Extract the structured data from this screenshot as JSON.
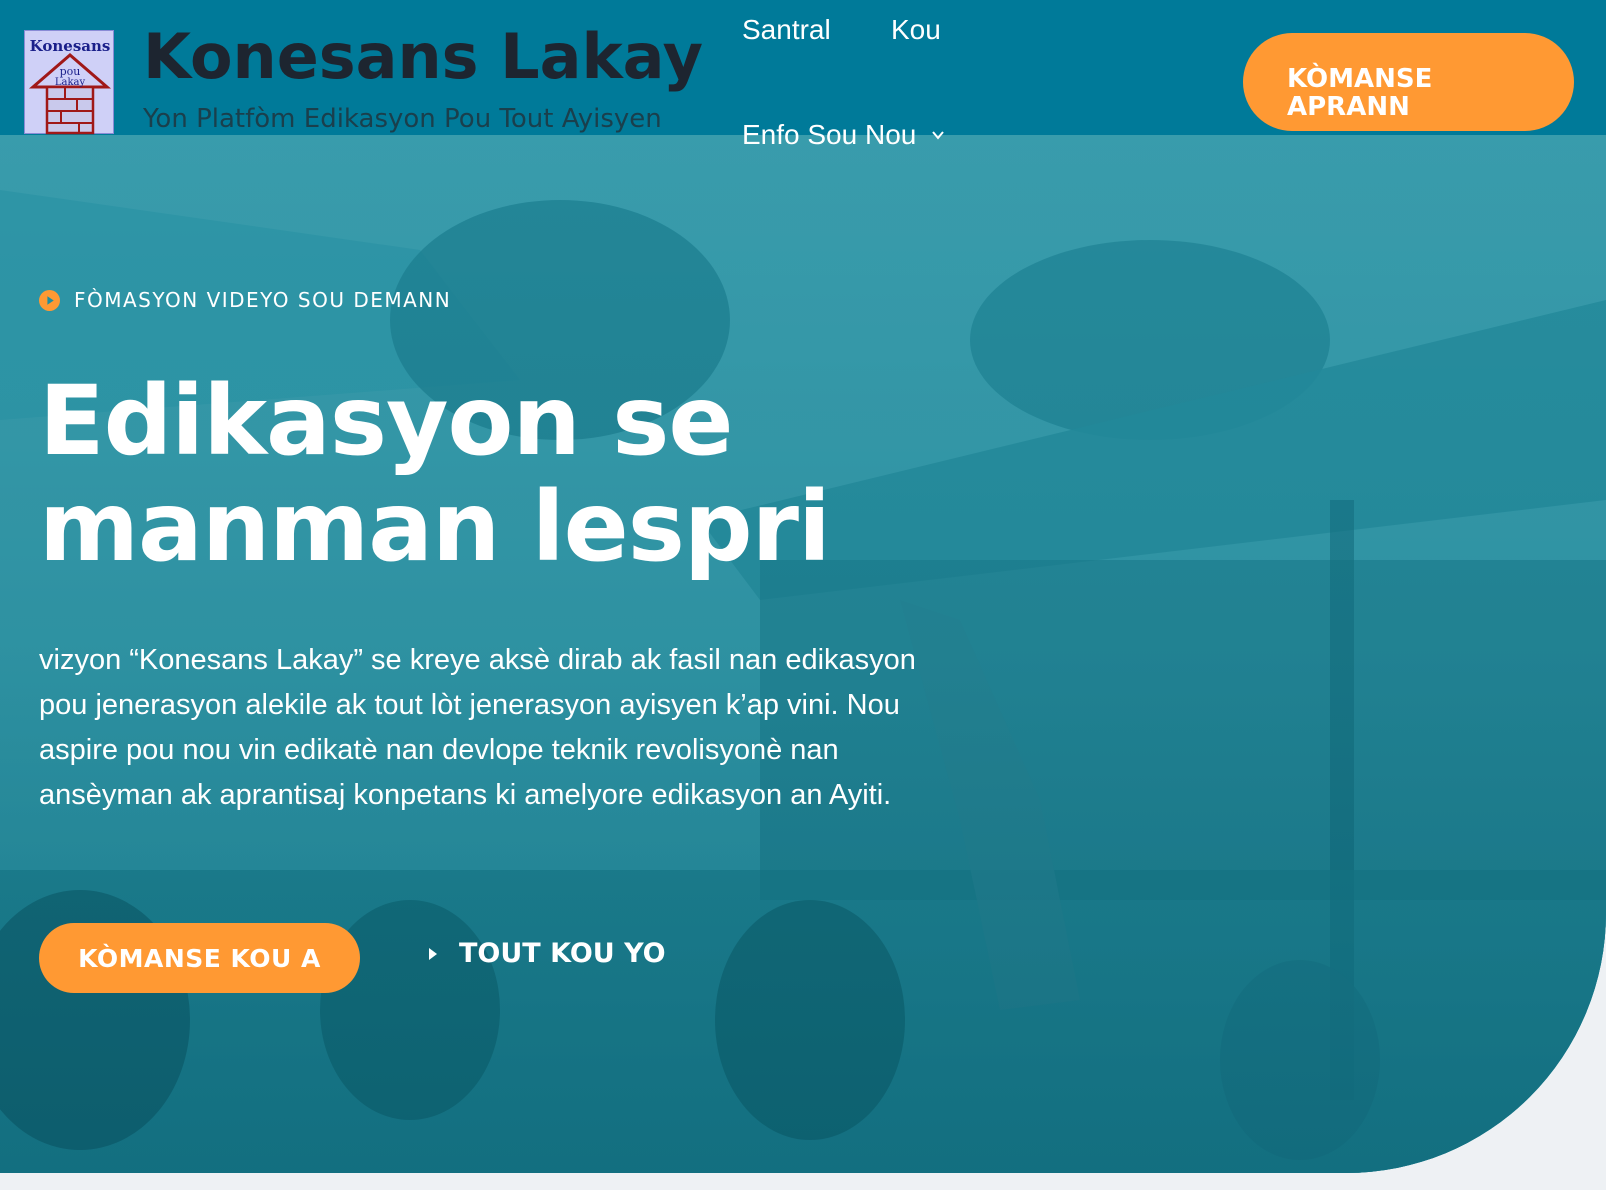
{
  "site": {
    "logo_text_top": "Konesans",
    "logo_text_mid": "pou",
    "logo_text_bottom": "Lakay",
    "title": "Konesans Lakay",
    "tagline": "Yon Platfòm Edikasyon Pou Tout Ayisyen"
  },
  "nav": {
    "items": [
      {
        "label": "Santral"
      },
      {
        "label": "Kou"
      },
      {
        "label": "Enfo Sou Nou",
        "icon": "chevron-down-icon"
      }
    ],
    "cta_line1": "KÒMANSE",
    "cta_line2": "APRANN"
  },
  "hero": {
    "eyebrow": "FÒMASYON VIDEYO SOU DEMANN",
    "eyebrow_icon": "play-circle-icon",
    "headline_line1": "Edikasyon se",
    "headline_line2": "manman lespri",
    "body": "vizyon “Konesans Lakay” se kreye aksè dirab ak fasil  nan edikasyon pou jenerasyon alekile ak tout lòt jenerasyon ayisyen k’ap vini. Nou aspire pou nou vin edikatè nan devlope teknik revolisyonè nan ansèyman ak aprantisaj konpetans ki amelyore edikasyon an Ayiti.",
    "primary_cta": "KÒMANSE KOU A",
    "secondary_cta": "TOUT KOU YO",
    "secondary_icon": "triangle-right-icon"
  },
  "colors": {
    "header_bg": "#007a99",
    "accent_orange": "#ff9933",
    "hero_tint": "#1f8ea0",
    "page_bg": "#eef1f4"
  }
}
